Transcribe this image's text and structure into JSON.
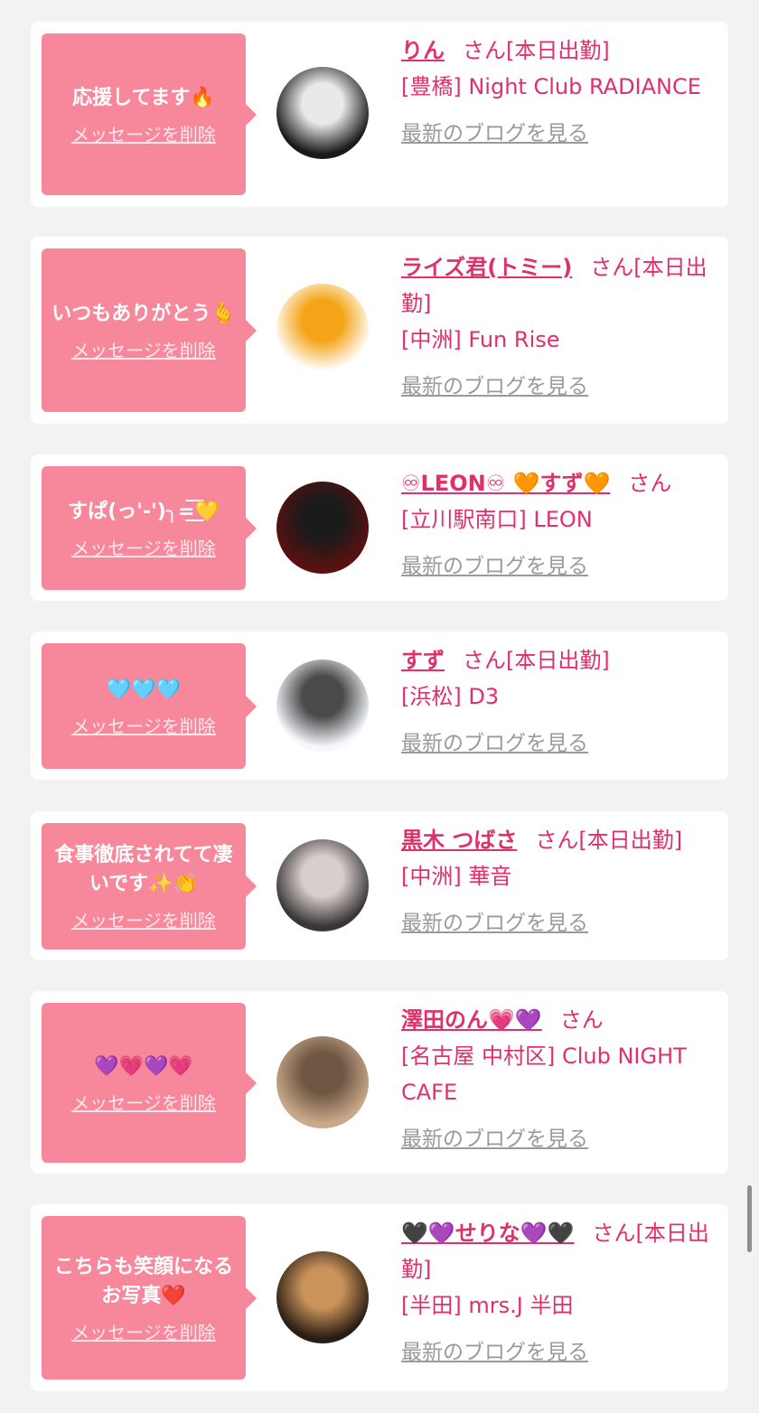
{
  "cards": [
    {
      "message": "応援してます🔥",
      "delete_label": "メッセージを削除",
      "name": "りん",
      "suffix": "さん",
      "status": "[本日出勤]",
      "shop": "[豊橋] Night Club RADIANCE",
      "blog_label": "最新のブログを見る",
      "avatar_colors": [
        "#1a1a1a",
        "#e9e9ea"
      ]
    },
    {
      "message": "いつもありがとう🫰",
      "delete_label": "メッセージを削除",
      "name": "ライズ君(トミー)",
      "suffix": "さん",
      "status": "[本日出勤]",
      "shop": "[中洲] Fun Rise",
      "blog_label": "最新のブログを見る",
      "avatar_colors": [
        "#ffffff",
        "#f4a416"
      ]
    },
    {
      "message": "すぱ(っ'-')╮=͟͟͞͞💛",
      "delete_label": "メッセージを削除",
      "name": "♾LEON♾ 🧡すず🧡",
      "suffix": "さん",
      "status": "",
      "shop": "[立川駅南口] LEON",
      "blog_label": "最新のブログを見る",
      "avatar_colors": [
        "#5a1010",
        "#1b1b1b"
      ]
    },
    {
      "message": "🩵🩵🩵",
      "delete_label": "メッセージを削除",
      "name": "すず",
      "suffix": "さん",
      "status": "[本日出勤]",
      "shop": "[浜松] D3",
      "blog_label": "最新のブログを見る",
      "avatar_colors": [
        "#f5f7fb",
        "#4a4a4a"
      ]
    },
    {
      "message": "食事徹底されてて凄いです✨👏",
      "delete_label": "メッセージを削除",
      "name": "黒木 つばさ",
      "suffix": "さん",
      "status": "[本日出勤]",
      "shop": "[中洲] 華音",
      "blog_label": "最新のブログを見る",
      "avatar_colors": [
        "#3a3638",
        "#d8cfcc"
      ]
    },
    {
      "message": "💜💗💜💗",
      "delete_label": "メッセージを削除",
      "name": "澤田のん💗💜",
      "suffix": "さん",
      "status": "",
      "shop": "[名古屋 中村区] Club NIGHT CAFE",
      "blog_label": "最新のブログを見る",
      "avatar_colors": [
        "#c9a98a",
        "#6e5643"
      ]
    },
    {
      "message": "こちらも笑顔になるお写真❤️",
      "delete_label": "メッセージを削除",
      "name": "🖤💜せりな💜🖤",
      "suffix": "さん",
      "status": "[本日出勤]",
      "shop": "[半田] mrs.J 半田",
      "blog_label": "最新のブログを見る",
      "avatar_colors": [
        "#2a1d14",
        "#c9935a"
      ]
    }
  ]
}
